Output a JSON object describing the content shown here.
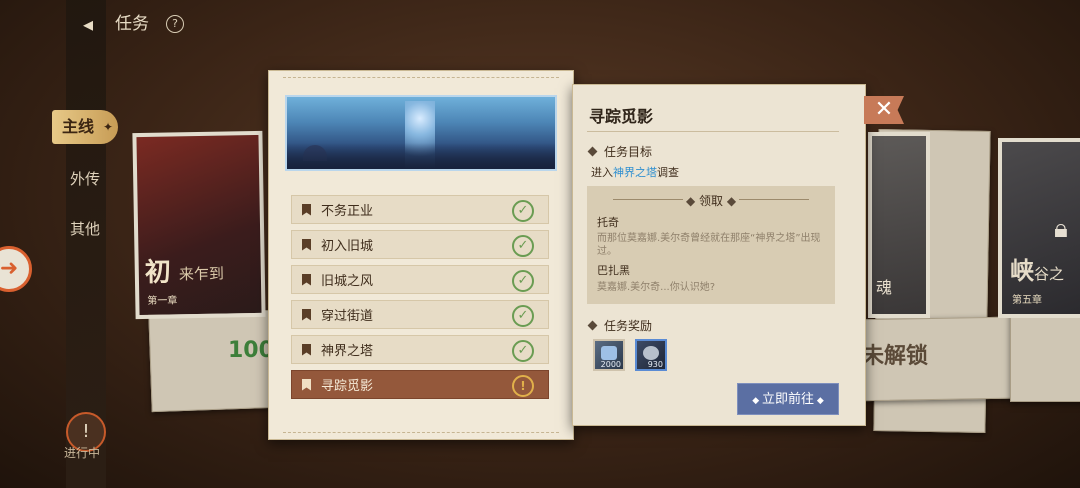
{
  "header": {
    "title": "任务",
    "back_icon": "back-icon",
    "help_glyph": "?"
  },
  "nav": {
    "main": "主线",
    "side": "外传",
    "other": "其他"
  },
  "ongoing": {
    "label": "进行中",
    "icon": "!"
  },
  "background": {
    "left_card": {
      "title_big": "初",
      "title_rest": "来乍到",
      "chapter": "第一章"
    },
    "right_card": {
      "title_big": "峡",
      "title_rest": "谷之",
      "chapter": "第五章"
    },
    "middle_card": {
      "title": "魂"
    },
    "locked_text": "未解锁",
    "number": "100"
  },
  "quest_list": [
    {
      "name": "不务正业",
      "status": "done"
    },
    {
      "name": "初入旧城",
      "status": "done"
    },
    {
      "name": "旧城之风",
      "status": "done"
    },
    {
      "name": "穿过街道",
      "status": "done"
    },
    {
      "name": "神界之塔",
      "status": "done"
    },
    {
      "name": "寻踪觅影",
      "status": "active"
    }
  ],
  "detail": {
    "title": "寻踪觅影",
    "goal_label": "任务目标",
    "goal_prefix": "进入",
    "goal_place": "神界之塔",
    "goal_suffix": "调查",
    "dialog_header": "领取",
    "speaker1": "托奇",
    "line1": "而那位莫嘉娜.美尔奇曾经就在那座“神界之塔”出现过。",
    "speaker2": "巴扎黑",
    "line2": "莫嘉娜.美尔奇...你认识她?",
    "reward_label": "任务奖励",
    "rewards": [
      {
        "name": "ticket-reward",
        "count": "2000"
      },
      {
        "name": "coin-reward",
        "count": "930"
      }
    ],
    "go_button": "立即前往"
  },
  "colors": {
    "accent": "#94583b",
    "button": "#5b6fa3",
    "highlight": "#2f8fd0",
    "check": "#6a9c52"
  }
}
